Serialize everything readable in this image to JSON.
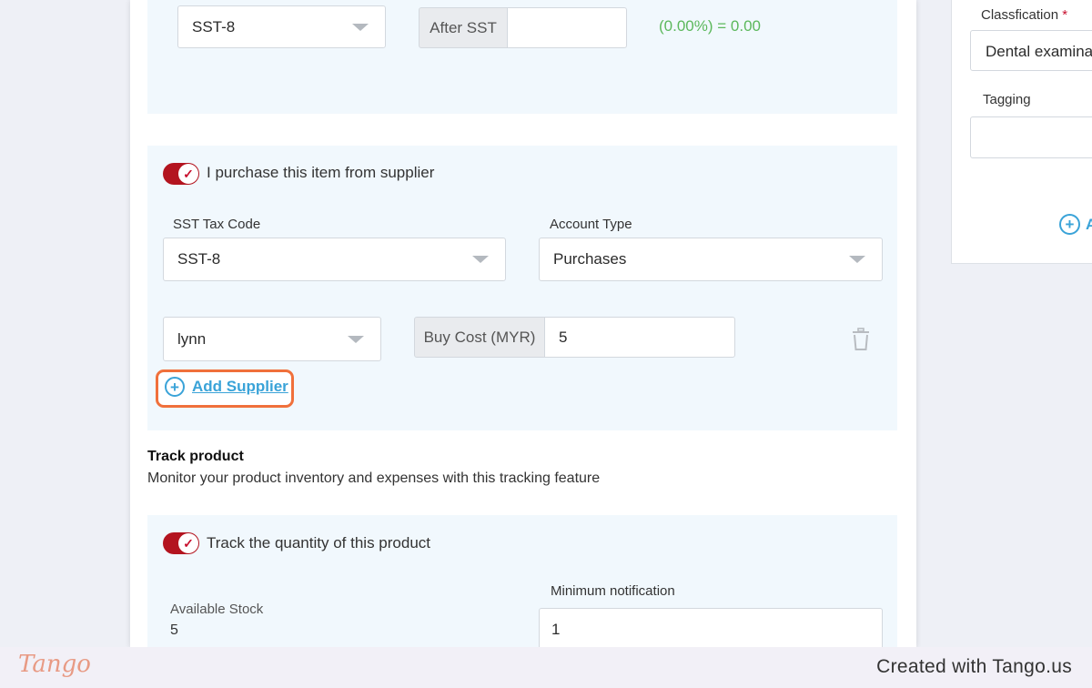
{
  "tax_section": {
    "tax_code_value": "SST-8",
    "after_sst_label": "After SST",
    "after_sst_value": "",
    "computed_text": "(0.00%) = 0.00"
  },
  "purchase_section": {
    "toggle_label": "I purchase this item from supplier",
    "sst_tax_code_label": "SST Tax Code",
    "sst_tax_code_value": "SST-8",
    "account_type_label": "Account Type",
    "account_type_value": "Purchases",
    "supplier_value": "lynn",
    "buy_cost_label": "Buy Cost (MYR)",
    "buy_cost_value": "5",
    "add_supplier_label": "Add Supplier"
  },
  "track_section": {
    "title": "Track product",
    "description": "Monitor your product inventory and expenses with this tracking feature",
    "toggle_label": "Track the quantity of this product",
    "available_stock_label": "Available Stock",
    "available_stock_value": "5",
    "min_notification_label": "Minimum notification",
    "min_notification_value": "1"
  },
  "side_panel": {
    "classification_label": "Classfication",
    "required_mark": "*",
    "classification_value": "Dental examina",
    "tagging_label": "Tagging",
    "tagging_value": "",
    "add_link_partial": "A"
  },
  "footer": {
    "logo_text": "Tango",
    "created_text": "Created with Tango.us"
  },
  "colors": {
    "accent_red": "#b3141f",
    "highlight_orange": "#f0703b",
    "link_blue": "#3aa3d8",
    "computed_green": "#5cb85c"
  }
}
